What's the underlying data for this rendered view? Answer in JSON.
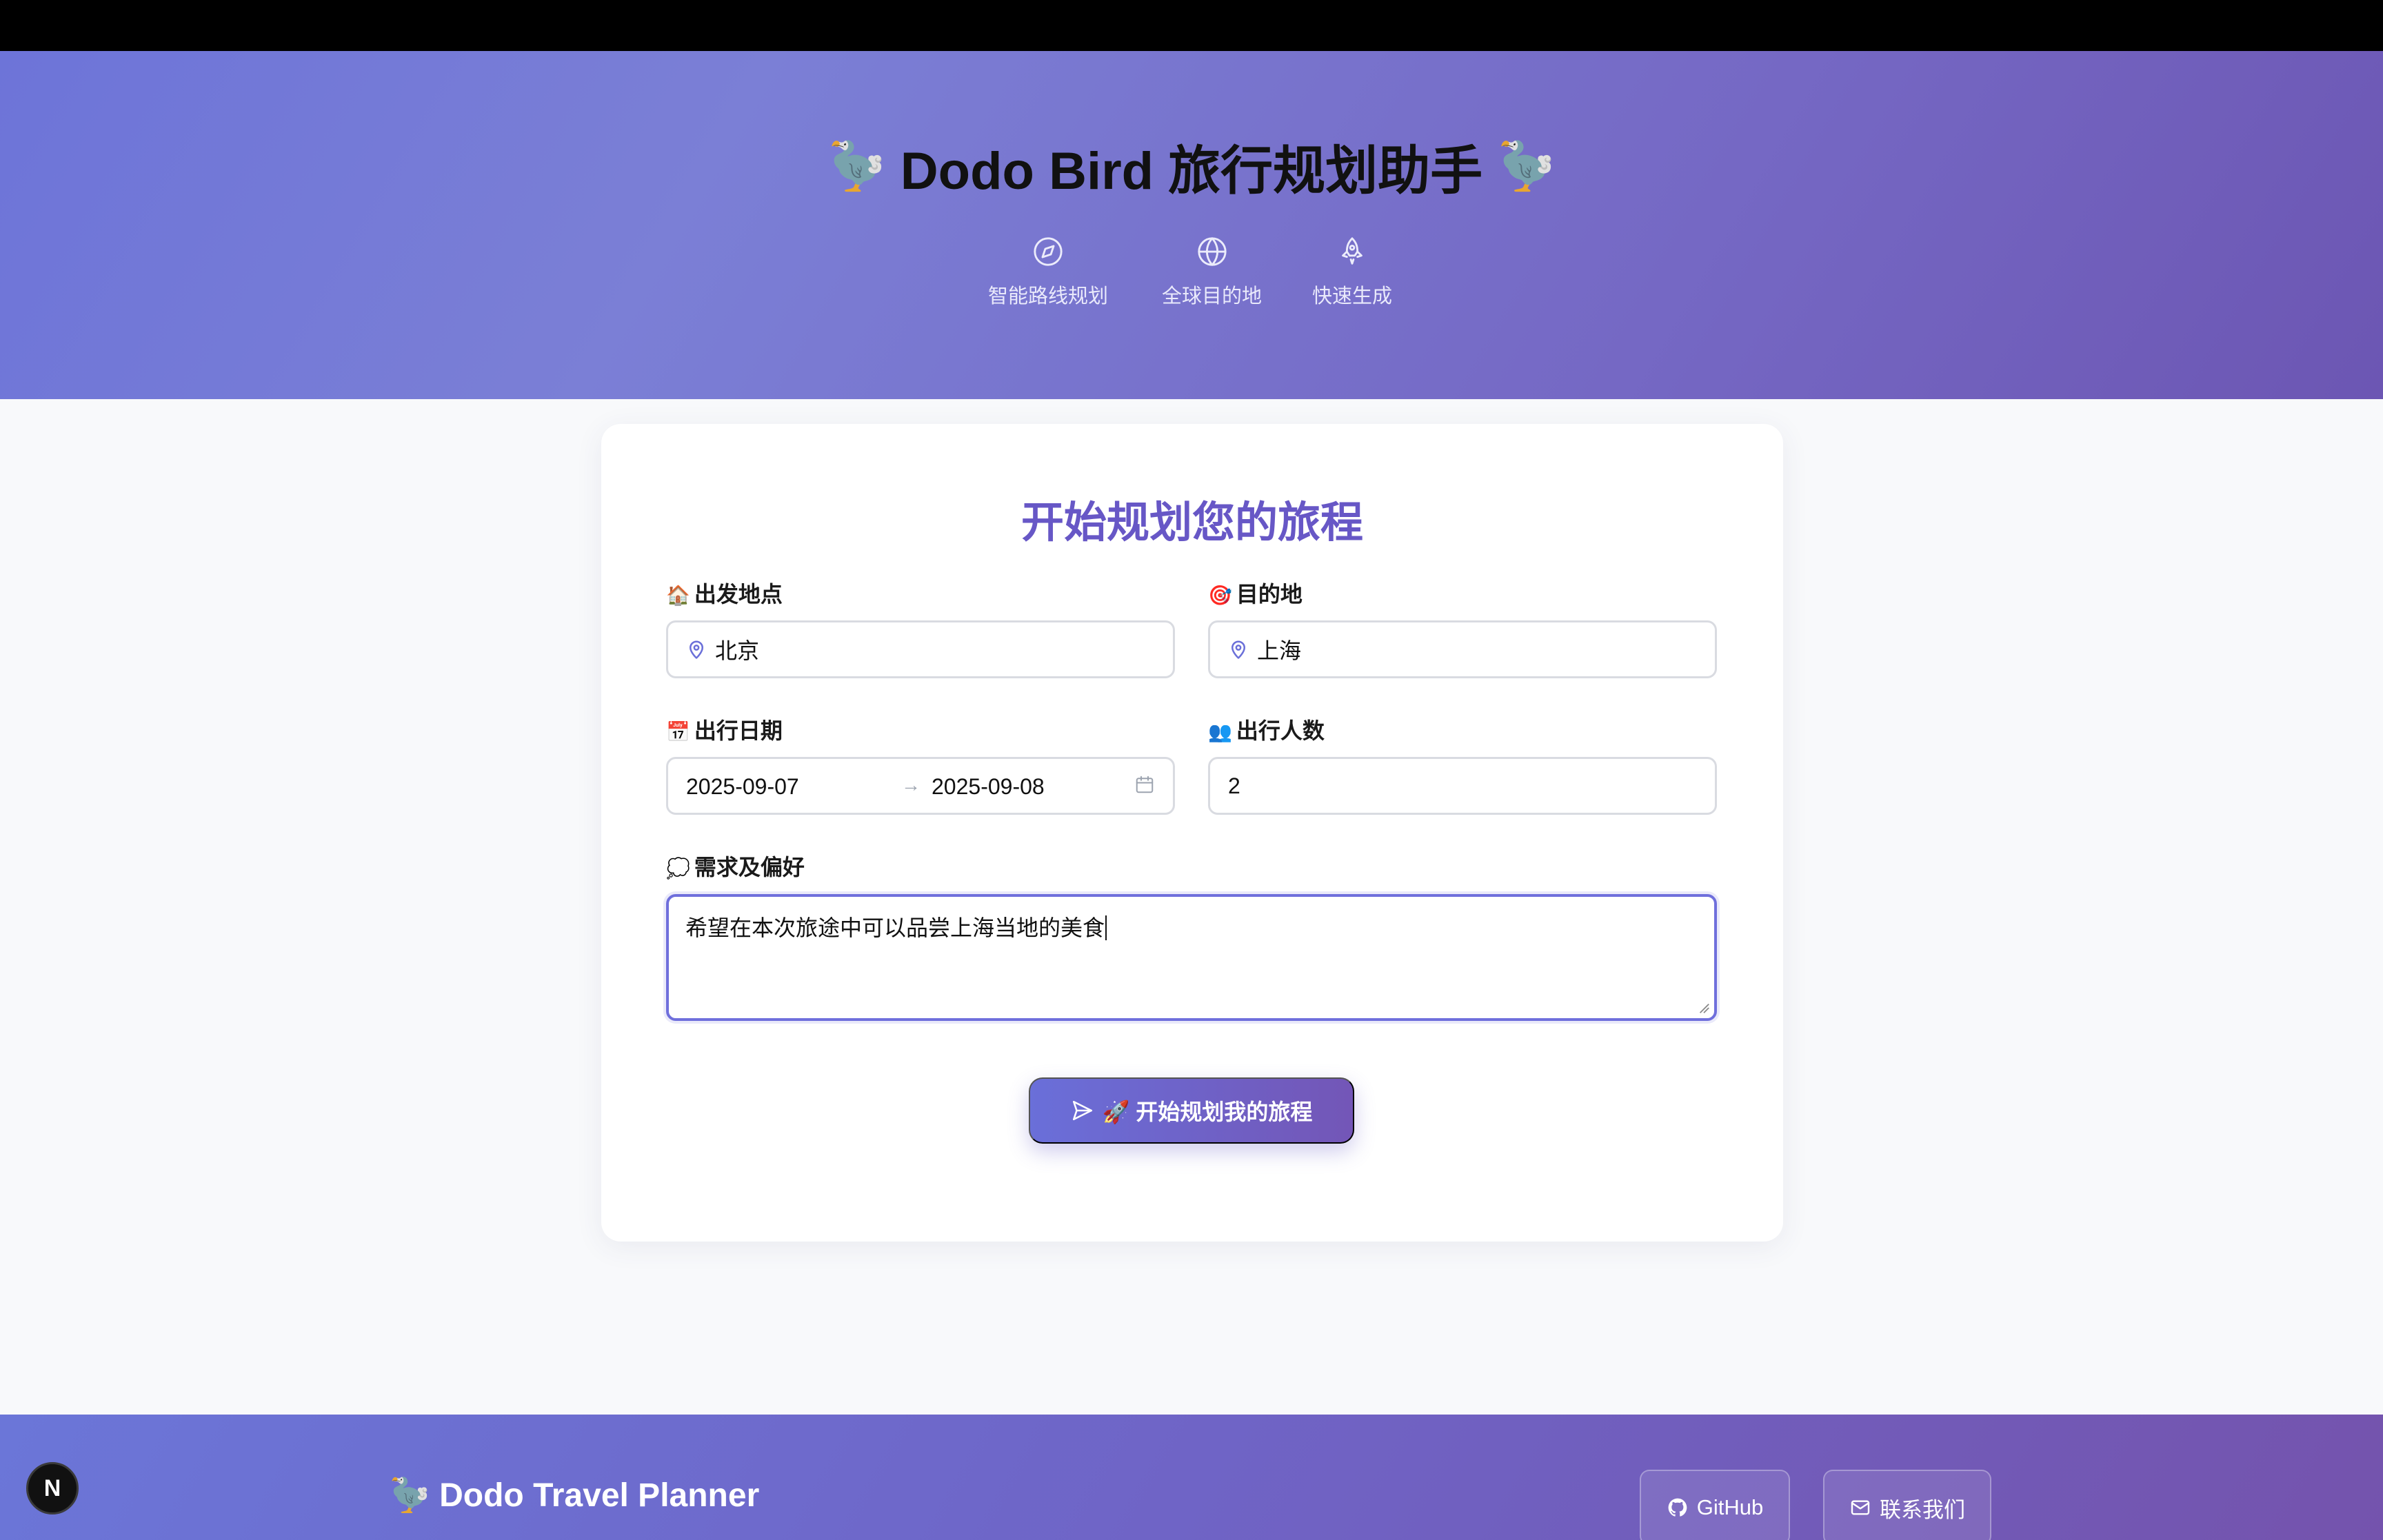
{
  "header": {
    "title": "Dodo Bird 旅行规划助手",
    "title_emoji": "🦤",
    "features": [
      {
        "icon": "compass-icon",
        "label": "智能路线规划"
      },
      {
        "icon": "globe-icon",
        "label": "全球目的地"
      },
      {
        "icon": "rocket-icon",
        "label": "快速生成"
      }
    ]
  },
  "form": {
    "title": "开始规划您的旅程",
    "origin": {
      "emoji": "🏠",
      "label": "出发地点",
      "value": "北京"
    },
    "destination": {
      "emoji": "🎯",
      "label": "目的地",
      "value": "上海"
    },
    "dates": {
      "emoji": "📅",
      "label": "出行日期",
      "start": "2025-09-07",
      "arrow": "→",
      "end": "2025-09-08"
    },
    "travelers": {
      "emoji": "👥",
      "label": "出行人数",
      "value": "2"
    },
    "preferences": {
      "emoji": "💭",
      "label": "需求及偏好",
      "value": "希望在本次旅途中可以品尝上海当地的美食"
    },
    "submit_label": "🚀 开始规划我的旅程"
  },
  "footer": {
    "brand_emoji": "🦤",
    "brand": "Dodo Travel Planner",
    "github_label": "GitHub",
    "contact_label": "联系我们"
  },
  "dev_badge": "N",
  "colors": {
    "accent": "#6757c6",
    "focus_border": "#6f6fdc",
    "hero_start": "#6d74d8",
    "hero_end": "#6c56b3"
  }
}
